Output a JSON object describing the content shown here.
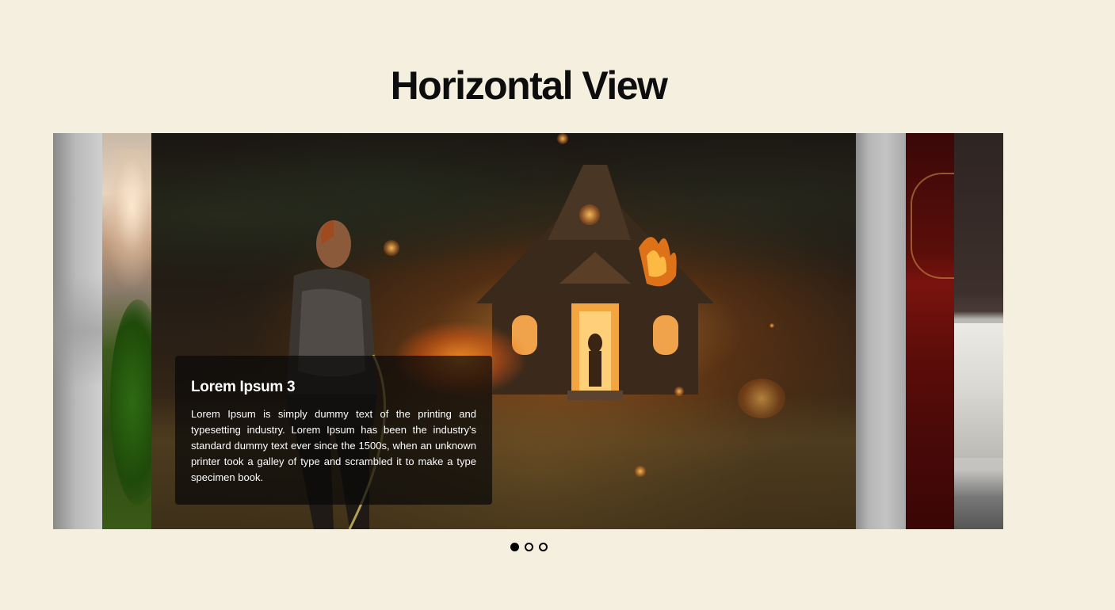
{
  "page": {
    "title": "Horizontal View"
  },
  "slider": {
    "active_index": 2,
    "slides": [
      {
        "image": "blurred-gray-interior"
      },
      {
        "image": "blurred-green-plant"
      },
      {
        "image": "burning-house-night",
        "caption_title": "Lorem Ipsum 3",
        "caption_text": "Lorem Ipsum is simply dummy text of the printing and typesetting industry. Lorem Ipsum has been the industry's standard dummy text ever since the 1500s, when an unknown printer took a galley of type and scrambled it to make a type specimen book."
      },
      {
        "image": "gray-concrete"
      },
      {
        "image": "red-ornate-bedroom"
      },
      {
        "image": "white-bathtub"
      }
    ],
    "pagination": [
      {
        "active": true
      },
      {
        "active": false
      },
      {
        "active": false
      }
    ]
  },
  "colors": {
    "background": "#f5efe0",
    "title": "#0d0d0d",
    "caption_bg": "rgba(8,8,8,0.72)",
    "dot": "#000000"
  }
}
